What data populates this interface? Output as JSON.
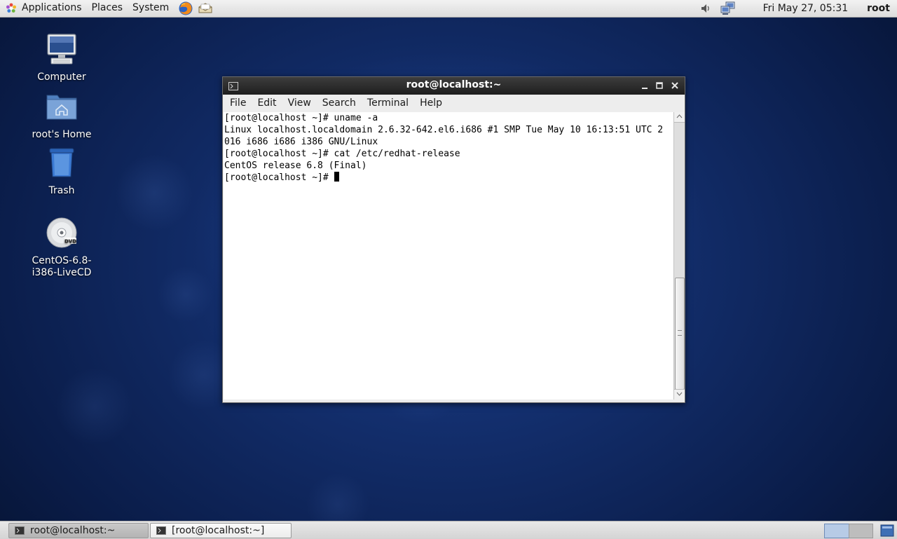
{
  "top_panel": {
    "menus": [
      "Applications",
      "Places",
      "System"
    ],
    "clock": "Fri May 27, 05:31",
    "user": "root",
    "launchers": [
      "firefox-icon",
      "mail-icon"
    ],
    "tray": [
      "volume-icon",
      "network-icon"
    ]
  },
  "desktop_icons": [
    {
      "label": "Computer",
      "icon": "computer-icon"
    },
    {
      "label": "root's Home",
      "icon": "home-folder-icon"
    },
    {
      "label": "Trash",
      "icon": "trash-icon"
    },
    {
      "label": "CentOS-6.8-i386-LiveCD",
      "icon": "dvd-icon",
      "badge": "DVD"
    }
  ],
  "terminal": {
    "title": "root@localhost:~",
    "menu": [
      "File",
      "Edit",
      "View",
      "Search",
      "Terminal",
      "Help"
    ],
    "lines": [
      "[root@localhost ~]# uname -a",
      "Linux localhost.localdomain 2.6.32-642.el6.i686 #1 SMP Tue May 10 16:13:51 UTC 2",
      "016 i686 i686 i386 GNU/Linux",
      "[root@localhost ~]# cat /etc/redhat-release",
      "CentOS release 6.8 (Final)",
      "[root@localhost ~]# "
    ]
  },
  "taskbar": {
    "tasks": [
      "root@localhost:~",
      "[root@localhost:~]"
    ]
  },
  "colors": {
    "desktop_bg": "#0b1d45",
    "panel_bg": "#e4e4e4",
    "titlebar": "#2a2a2a",
    "terminal_bg": "#ffffff"
  }
}
